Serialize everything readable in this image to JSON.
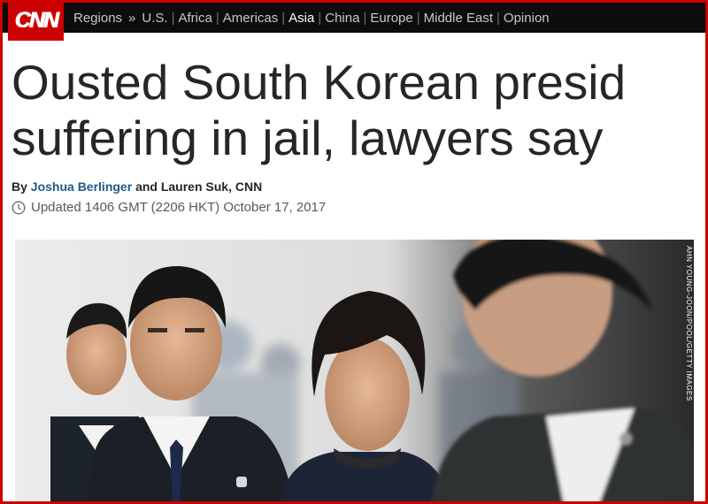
{
  "brand": {
    "logo": "CNN",
    "accent": "#cc0000"
  },
  "nav": {
    "regions_label": "Regions",
    "chevron": "»",
    "items": [
      "U.S.",
      "Africa",
      "Americas",
      "Asia",
      "China",
      "Europe",
      "Middle East",
      "Opinion"
    ],
    "active": "Asia"
  },
  "article": {
    "headline_line1": "Ousted South Korean presid",
    "headline_line2": "suffering in jail, lawyers say",
    "byline_prefix": "By",
    "author1": "Joshua Berlinger",
    "byline_rest": "and Lauren Suk, CNN",
    "updated": "Updated 1406 GMT (2206 HKT) October 17, 2017",
    "clock_icon": "clock-icon",
    "photo_credit": "AHN YOUNG-JOON/POOL/GETTY IMAGES"
  }
}
